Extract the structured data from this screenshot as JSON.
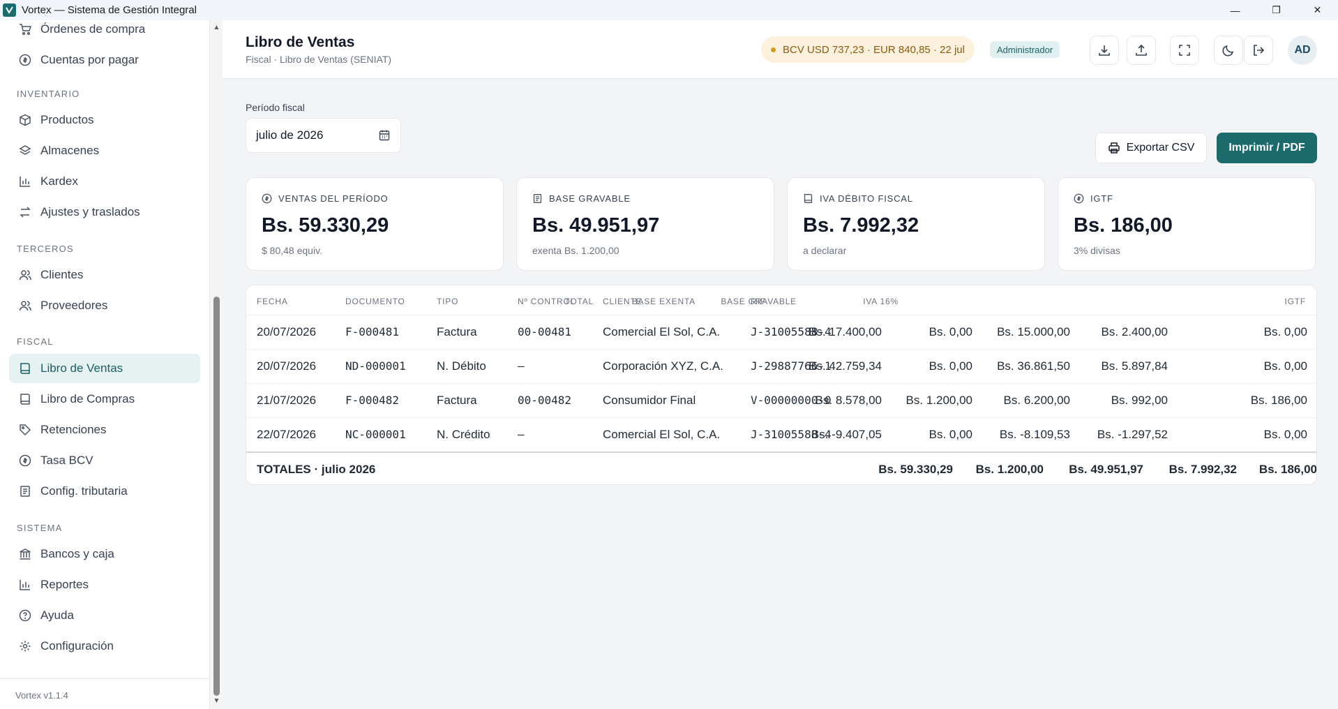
{
  "window": {
    "title": "Vortex — Sistema de Gestión Integral",
    "minimize": "—",
    "restore": "❐",
    "close": "✕"
  },
  "sidebar": {
    "items_top": [
      {
        "label": "Órdenes de compra",
        "icon": "cart-icon"
      },
      {
        "label": "Cuentas por pagar",
        "icon": "dollar-circle-icon"
      }
    ],
    "sections": [
      {
        "label": "INVENTARIO",
        "items": [
          {
            "label": "Productos",
            "icon": "box-icon"
          },
          {
            "label": "Almacenes",
            "icon": "layers-icon"
          },
          {
            "label": "Kardex",
            "icon": "bar-chart-icon"
          },
          {
            "label": "Ajustes y traslados",
            "icon": "arrows-icon"
          }
        ]
      },
      {
        "label": "TERCEROS",
        "items": [
          {
            "label": "Clientes",
            "icon": "users-icon"
          },
          {
            "label": "Proveedores",
            "icon": "users-icon"
          }
        ]
      },
      {
        "label": "FISCAL",
        "items": [
          {
            "label": "Libro de Ventas",
            "icon": "book-icon",
            "active": true
          },
          {
            "label": "Libro de Compras",
            "icon": "book-icon"
          },
          {
            "label": "Retenciones",
            "icon": "tag-icon"
          },
          {
            "label": "Tasa BCV",
            "icon": "dollar-circle-icon"
          },
          {
            "label": "Config. tributaria",
            "icon": "receipt-icon"
          }
        ]
      },
      {
        "label": "SISTEMA",
        "items": [
          {
            "label": "Bancos y caja",
            "icon": "bank-icon"
          },
          {
            "label": "Reportes",
            "icon": "bar-chart-icon"
          },
          {
            "label": "Ayuda",
            "icon": "help-icon"
          },
          {
            "label": "Configuración",
            "icon": "gear-icon"
          }
        ]
      }
    ],
    "version": "Vortex v1.1.4"
  },
  "header": {
    "title": "Libro de Ventas",
    "breadcrumb": "Fiscal · Libro de Ventas (SENIAT)",
    "rate": "BCV USD 737,23 · EUR 840,85 · 22 jul",
    "role": "Administrador",
    "avatar": "AD"
  },
  "period": {
    "label": "Período fiscal",
    "value": "julio de 2026"
  },
  "actions": {
    "export_csv": "Exportar CSV",
    "print_pdf": "Imprimir / PDF"
  },
  "cards": [
    {
      "label": "VENTAS DEL PERÍODO",
      "value": "Bs. 59.330,29",
      "sub": "$ 80,48 equiv.",
      "icon": "dollar-circle-icon"
    },
    {
      "label": "BASE GRAVABLE",
      "value": "Bs. 49.951,97",
      "sub": "exenta Bs. 1.200,00",
      "icon": "receipt-icon"
    },
    {
      "label": "IVA DÉBITO FISCAL",
      "value": "Bs. 7.992,32",
      "sub": "a declarar",
      "icon": "book-icon"
    },
    {
      "label": "IGTF",
      "value": "Bs. 186,00",
      "sub": "3% divisas",
      "icon": "dollar-circle-icon"
    }
  ],
  "table": {
    "columns": [
      "FECHA",
      "DOCUMENTO",
      "TIPO",
      "Nº CONTROL",
      "CLIENTE",
      "RIF",
      "TOTAL",
      "BASE EXENTA",
      "BASE GRAVABLE",
      "IVA 16%",
      "IGTF"
    ],
    "rows": [
      [
        "20/07/2026",
        "F-000481",
        "Factura",
        "00-00481",
        "Comercial El Sol, C.A.",
        "J-31005588-4",
        "Bs. 17.400,00",
        "Bs. 0,00",
        "Bs. 15.000,00",
        "Bs. 2.400,00",
        "Bs. 0,00"
      ],
      [
        "20/07/2026",
        "ND-000001",
        "N. Débito",
        "—",
        "Corporación XYZ, C.A.",
        "J-29887766-1",
        "Bs. 42.759,34",
        "Bs. 0,00",
        "Bs. 36.861,50",
        "Bs. 5.897,84",
        "Bs. 0,00"
      ],
      [
        "21/07/2026",
        "F-000482",
        "Factura",
        "00-00482",
        "Consumidor Final",
        "V-00000000-0",
        "Bs. 8.578,00",
        "Bs. 1.200,00",
        "Bs. 6.200,00",
        "Bs. 992,00",
        "Bs. 186,00"
      ],
      [
        "22/07/2026",
        "NC-000001",
        "N. Crédito",
        "—",
        "Comercial El Sol, C.A.",
        "J-31005588-4",
        "Bs. -9.407,05",
        "Bs. 0,00",
        "Bs. -8.109,53",
        "Bs. -1.297,52",
        "Bs. 0,00"
      ]
    ],
    "totals": {
      "label": "TOTALES · julio 2026",
      "total": "Bs. 59.330,29",
      "exenta": "Bs. 1.200,00",
      "gravable": "Bs. 49.951,97",
      "iva": "Bs. 7.992,32",
      "igtf": "Bs. 186,00"
    }
  },
  "colors": {
    "accent": "#1b6b6d",
    "active_bg": "#e6f1f1",
    "rate_bg": "#fbf1dc"
  }
}
